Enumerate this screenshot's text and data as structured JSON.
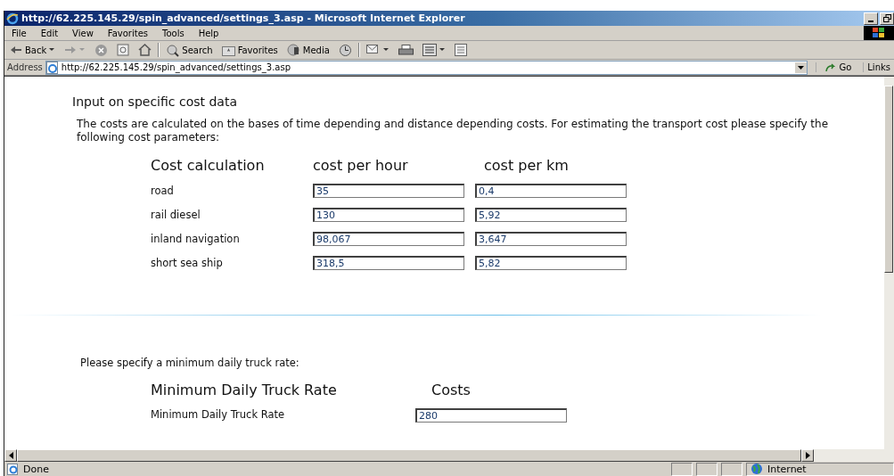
{
  "window": {
    "title": "http://62.225.145.29/spin_advanced/settings_3.asp - Microsoft Internet Explorer"
  },
  "menu": [
    "File",
    "Edit",
    "View",
    "Favorites",
    "Tools",
    "Help"
  ],
  "toolbar": {
    "back": "Back",
    "search": "Search",
    "favorites": "Favorites",
    "media": "Media"
  },
  "address": {
    "label": "Address",
    "url": "http://62.225.145.29/spin_advanced/settings_3.asp",
    "go": "Go",
    "links": "Links"
  },
  "page": {
    "heading": "Input on specific cost data",
    "intro": "The costs are calculated on the bases of time depending and distance depending costs. For estimating the transport cost please specify the following cost parameters:",
    "cost_table": {
      "columns": [
        "Cost calculation",
        "cost per hour",
        "cost per km"
      ],
      "rows": [
        {
          "label": "road",
          "per_hour": "35",
          "per_km": "0,4"
        },
        {
          "label": "rail diesel",
          "per_hour": "130",
          "per_km": "5,92"
        },
        {
          "label": "inland navigation",
          "per_hour": "98,067",
          "per_km": "3,647"
        },
        {
          "label": "short sea ship",
          "per_hour": "318,5",
          "per_km": "5,82"
        }
      ]
    },
    "truck_prompt": "Please specify a minimum daily truck rate:",
    "truck_table": {
      "columns": [
        "Minimum Daily Truck Rate",
        "Costs"
      ],
      "rows": [
        {
          "label": "Minimum Daily Truck Rate",
          "value": "280"
        }
      ]
    }
  },
  "status_bar": {
    "status": "Done",
    "zone": "Internet"
  }
}
